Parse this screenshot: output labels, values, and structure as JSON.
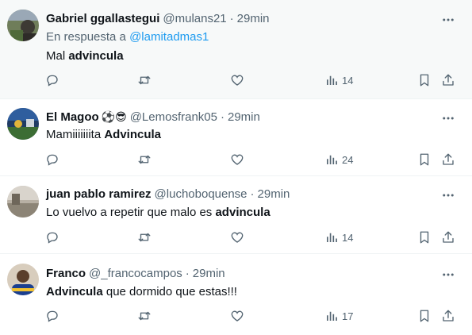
{
  "tweets": [
    {
      "name": "Gabriel ggallastegui",
      "handle": "@mulans21",
      "separator": "·",
      "time": "29min",
      "reply_prefix": "En respuesta a",
      "reply_mention": "@lamitadmas1",
      "text_plain": "Mal ",
      "text_bold": "advincula",
      "text_after": "",
      "views": "14",
      "highlight": true
    },
    {
      "name": "El Magoo",
      "emoji": "⚽😎",
      "handle": "@Lemosfrank05",
      "separator": "·",
      "time": "29min",
      "text_plain": "Mamiiiiiiita ",
      "text_bold": "Advincula",
      "text_after": "",
      "views": "24"
    },
    {
      "name": "juan pablo ramirez",
      "handle": "@luchoboquense",
      "separator": "·",
      "time": "29min",
      "text_plain": "Lo vuelvo a repetir que malo es ",
      "text_bold": "advincula",
      "text_after": "",
      "views": "14"
    },
    {
      "name": "Franco",
      "handle": "@_francocampos",
      "separator": "·",
      "time": "29min",
      "text_plain": "",
      "text_bold": "Advincula",
      "text_after": " que dormido que estas!!!",
      "views": "17"
    }
  ],
  "icons": {
    "more": "more-horizontal-icon",
    "reply": "reply-icon",
    "retweet": "retweet-icon",
    "like": "heart-icon",
    "views": "views-icon",
    "bookmark": "bookmark-icon",
    "share": "share-icon"
  },
  "colors": {
    "text": "#0f1419",
    "secondary": "#536471",
    "link": "#1d9bf0",
    "border": "#eff3f4",
    "highlight_bg": "#f7f9f9"
  }
}
